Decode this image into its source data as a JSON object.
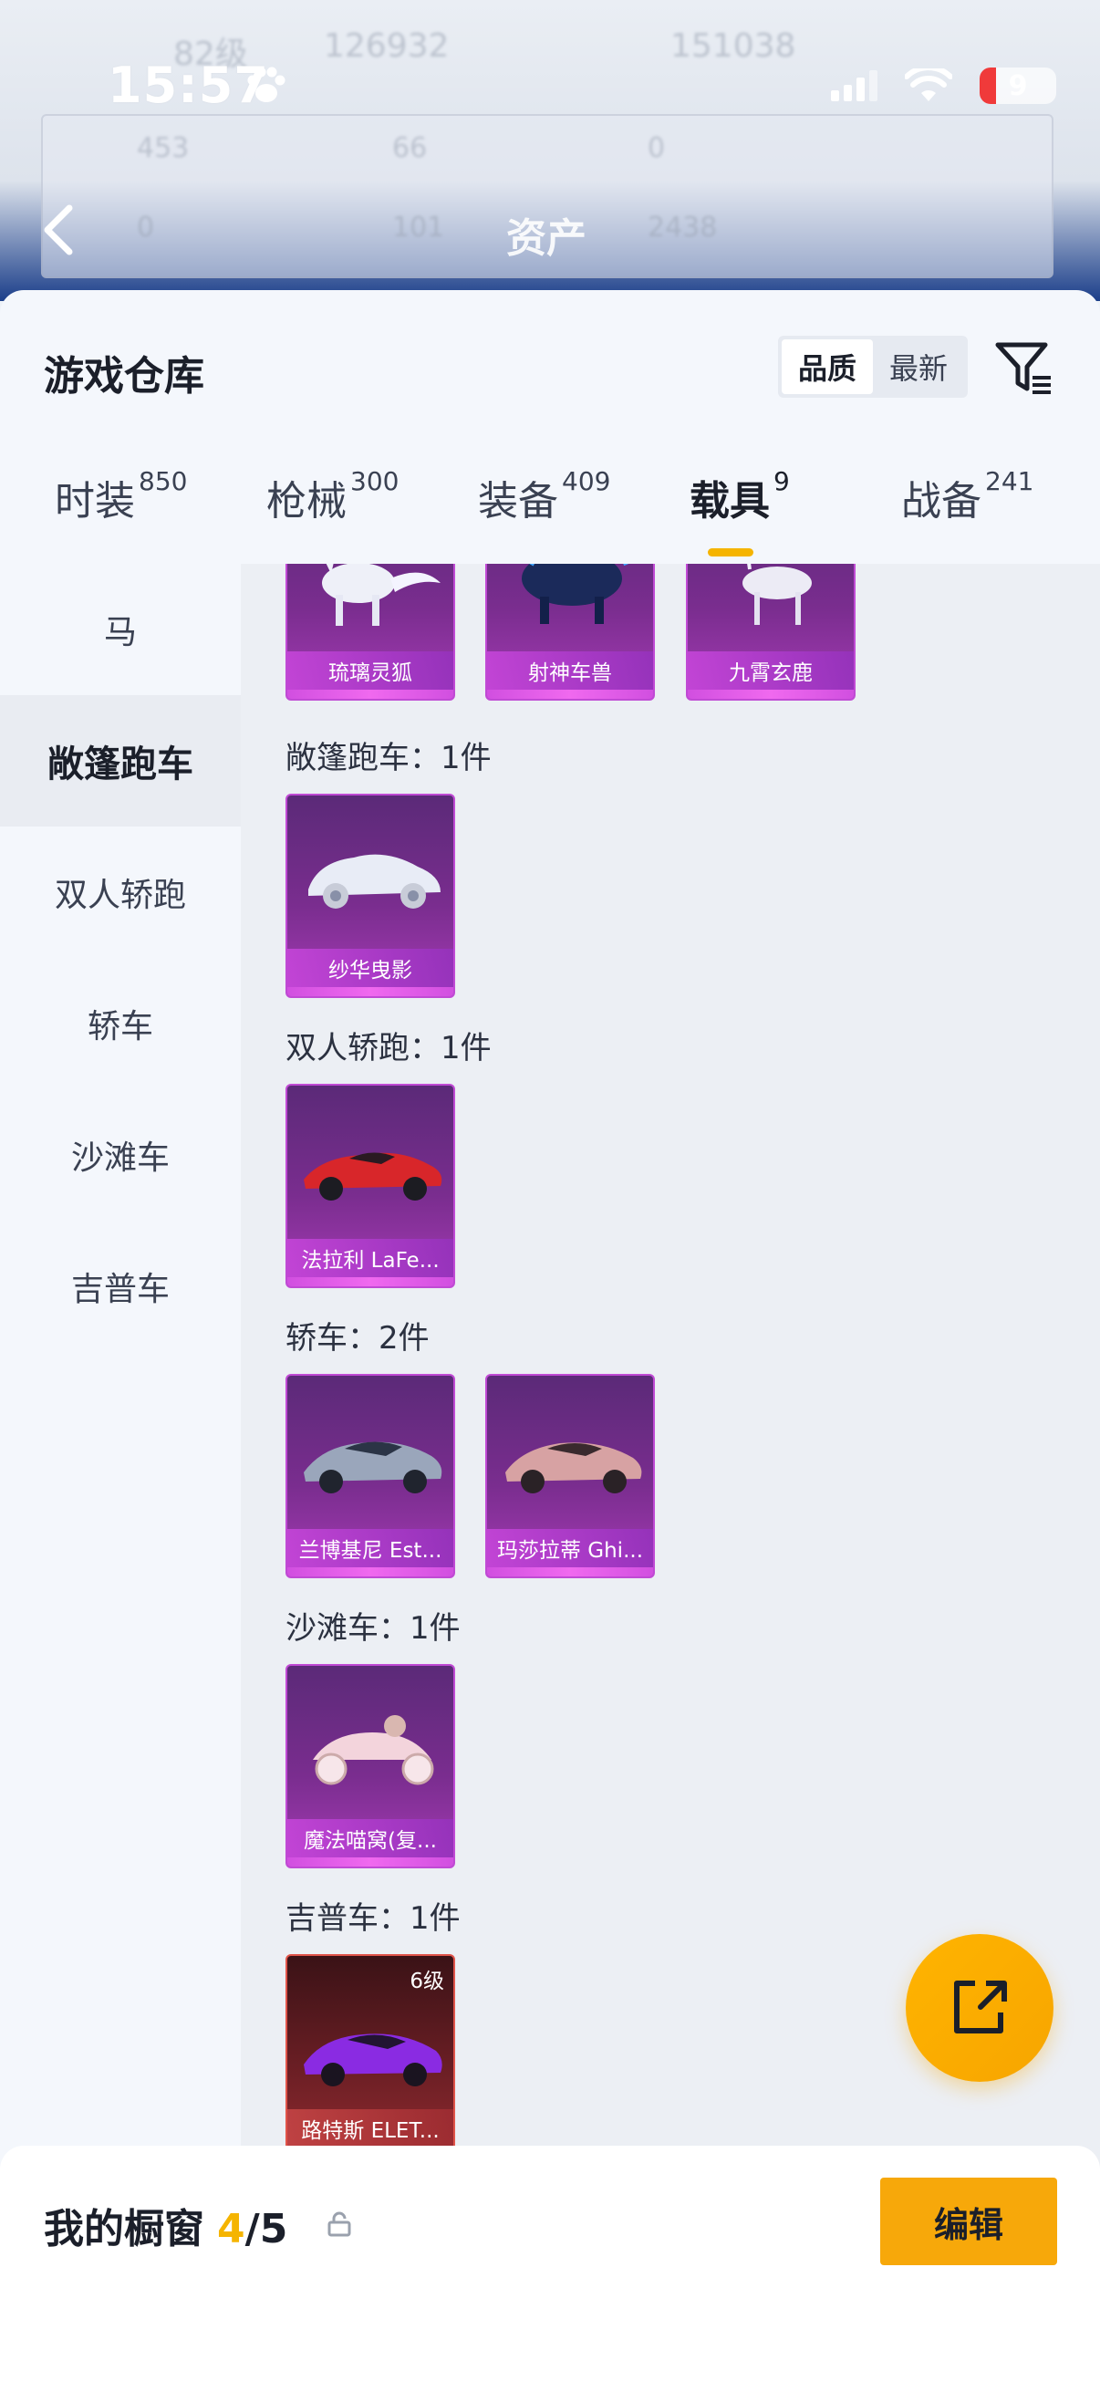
{
  "status_bar": {
    "time": "15:57",
    "battery": "9"
  },
  "background": {
    "title": "资产",
    "blur_texts": [
      "82级",
      "126932",
      "151038",
      "453",
      "66",
      "0",
      "0",
      "101",
      "2438"
    ]
  },
  "sheet": {
    "title": "游戏仓库",
    "sort_options": [
      "品质",
      "最新"
    ],
    "sort_active": "品质"
  },
  "tabs": [
    {
      "label": "时装",
      "count": "850"
    },
    {
      "label": "枪械",
      "count": "300"
    },
    {
      "label": "装备",
      "count": "409"
    },
    {
      "label": "载具",
      "count": "9",
      "active": true
    },
    {
      "label": "战备",
      "count": "241"
    }
  ],
  "categories": [
    {
      "label": "马"
    },
    {
      "label": "敞篷跑车",
      "active": true
    },
    {
      "label": "双人轿跑"
    },
    {
      "label": "轿车"
    },
    {
      "label": "沙滩车"
    },
    {
      "label": "吉普车"
    }
  ],
  "groups": [
    {
      "label": "",
      "items": [
        {
          "name": "琉璃灵狐",
          "icon": "white-fox-icon"
        },
        {
          "name": "射神车兽",
          "icon": "blue-beast-icon"
        },
        {
          "name": "九霄玄鹿",
          "icon": "white-deer-icon"
        }
      ]
    },
    {
      "label": "敞篷跑车：1件",
      "items": [
        {
          "name": "纱华曳影",
          "icon": "white-classic-car-icon"
        }
      ]
    },
    {
      "label": "双人轿跑：1件",
      "items": [
        {
          "name": "法拉利 LaFe...",
          "icon": "red-sports-car-icon"
        }
      ]
    },
    {
      "label": "轿车：2件",
      "items": [
        {
          "name": "兰博基尼 Est...",
          "icon": "silver-sedan-icon"
        },
        {
          "name": "玛莎拉蒂 Ghi...",
          "icon": "pink-sedan-icon"
        }
      ]
    },
    {
      "label": "沙滩车：1件",
      "items": [
        {
          "name": "魔法喵窝(复...",
          "icon": "pink-buggy-icon"
        }
      ]
    },
    {
      "label": "吉普车：1件",
      "items": [
        {
          "name": "路特斯 ELET...",
          "icon": "purple-suv-icon",
          "level": "6级",
          "rarity": "red"
        }
      ]
    }
  ],
  "bottom_bar": {
    "label": "我的橱窗",
    "count": "4",
    "total": "/5",
    "edit_label": "编辑"
  },
  "colors": {
    "accent": "#f5b400",
    "card_purple": "#7a2d8f",
    "card_red": "#6a1e24"
  }
}
